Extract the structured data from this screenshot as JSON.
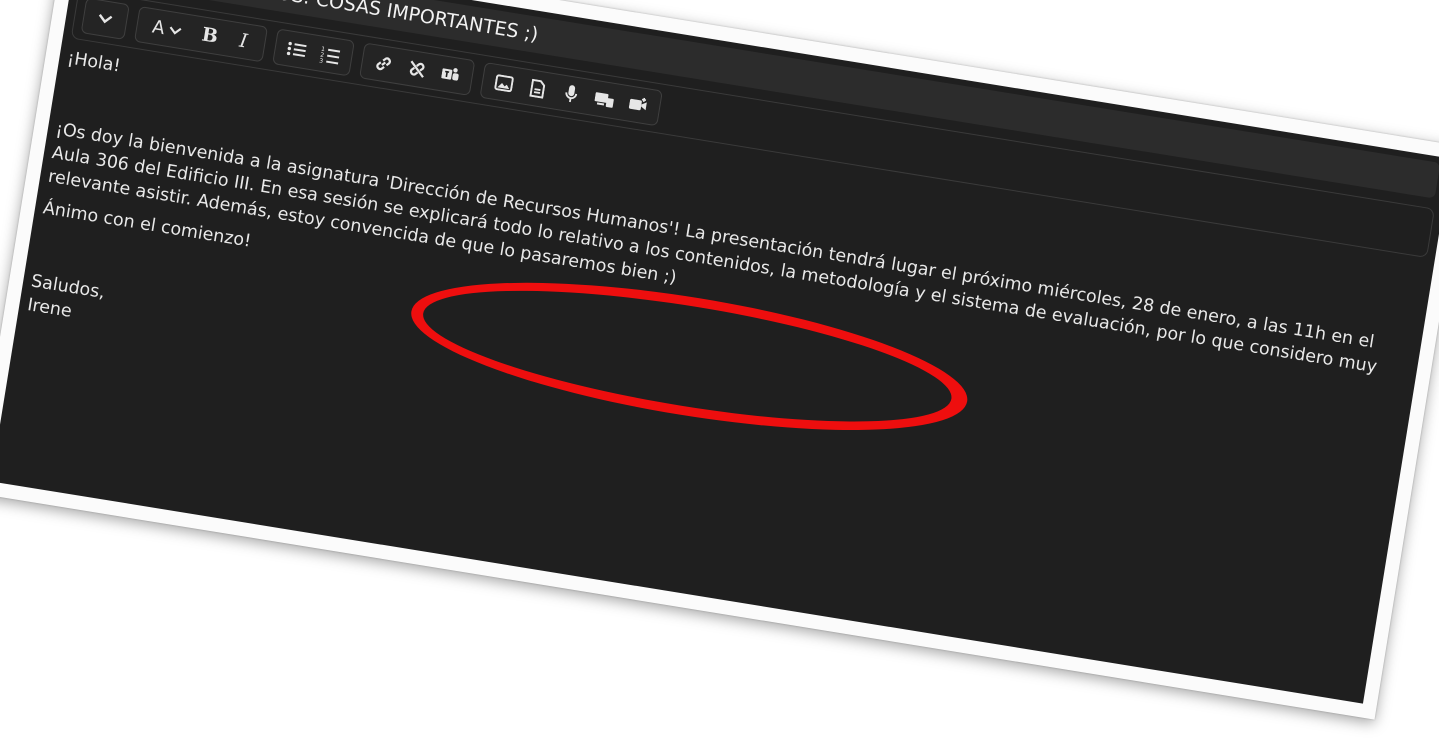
{
  "email": {
    "subject": "RECURSOS HUMANOS: COSAS IMPORTANTES ;)",
    "greeting": "¡Hola!",
    "paragraph": "¡Os doy la bienvenida a la asignatura 'Dirección de Recursos Humanos'! La presentación tendrá lugar el próximo miércoles, 28 de enero, a las 11h en el Aula 306 del Edificio III. En esa sesión se explicará todo lo relativo a los contenidos, la metodología y el sistema de evaluación, por lo que considero muy relevante asistir. Además, estoy convencida de que lo pasaremos bien ;)",
    "encouragement": "Ánimo con el comienzo!",
    "closing": "Saludos,",
    "signature": "Irene"
  },
  "toolbar": {
    "groups": [
      [
        "chevron-down-icon"
      ],
      [
        "font-color-icon",
        "bold-icon",
        "italic-icon"
      ],
      [
        "bullet-list-icon",
        "numbered-list-icon"
      ],
      [
        "link-icon",
        "unlink-icon",
        "teams-icon"
      ],
      [
        "image-icon",
        "file-icon",
        "microphone-icon",
        "screen-share-icon",
        "video-icon"
      ]
    ],
    "font_letter": "A",
    "bold_letter": "B",
    "italic_letter": "I"
  },
  "colors": {
    "editor_background": "#1f1f1f",
    "text": "#e8e8e8",
    "highlight_circle": "#ee0e0e"
  }
}
